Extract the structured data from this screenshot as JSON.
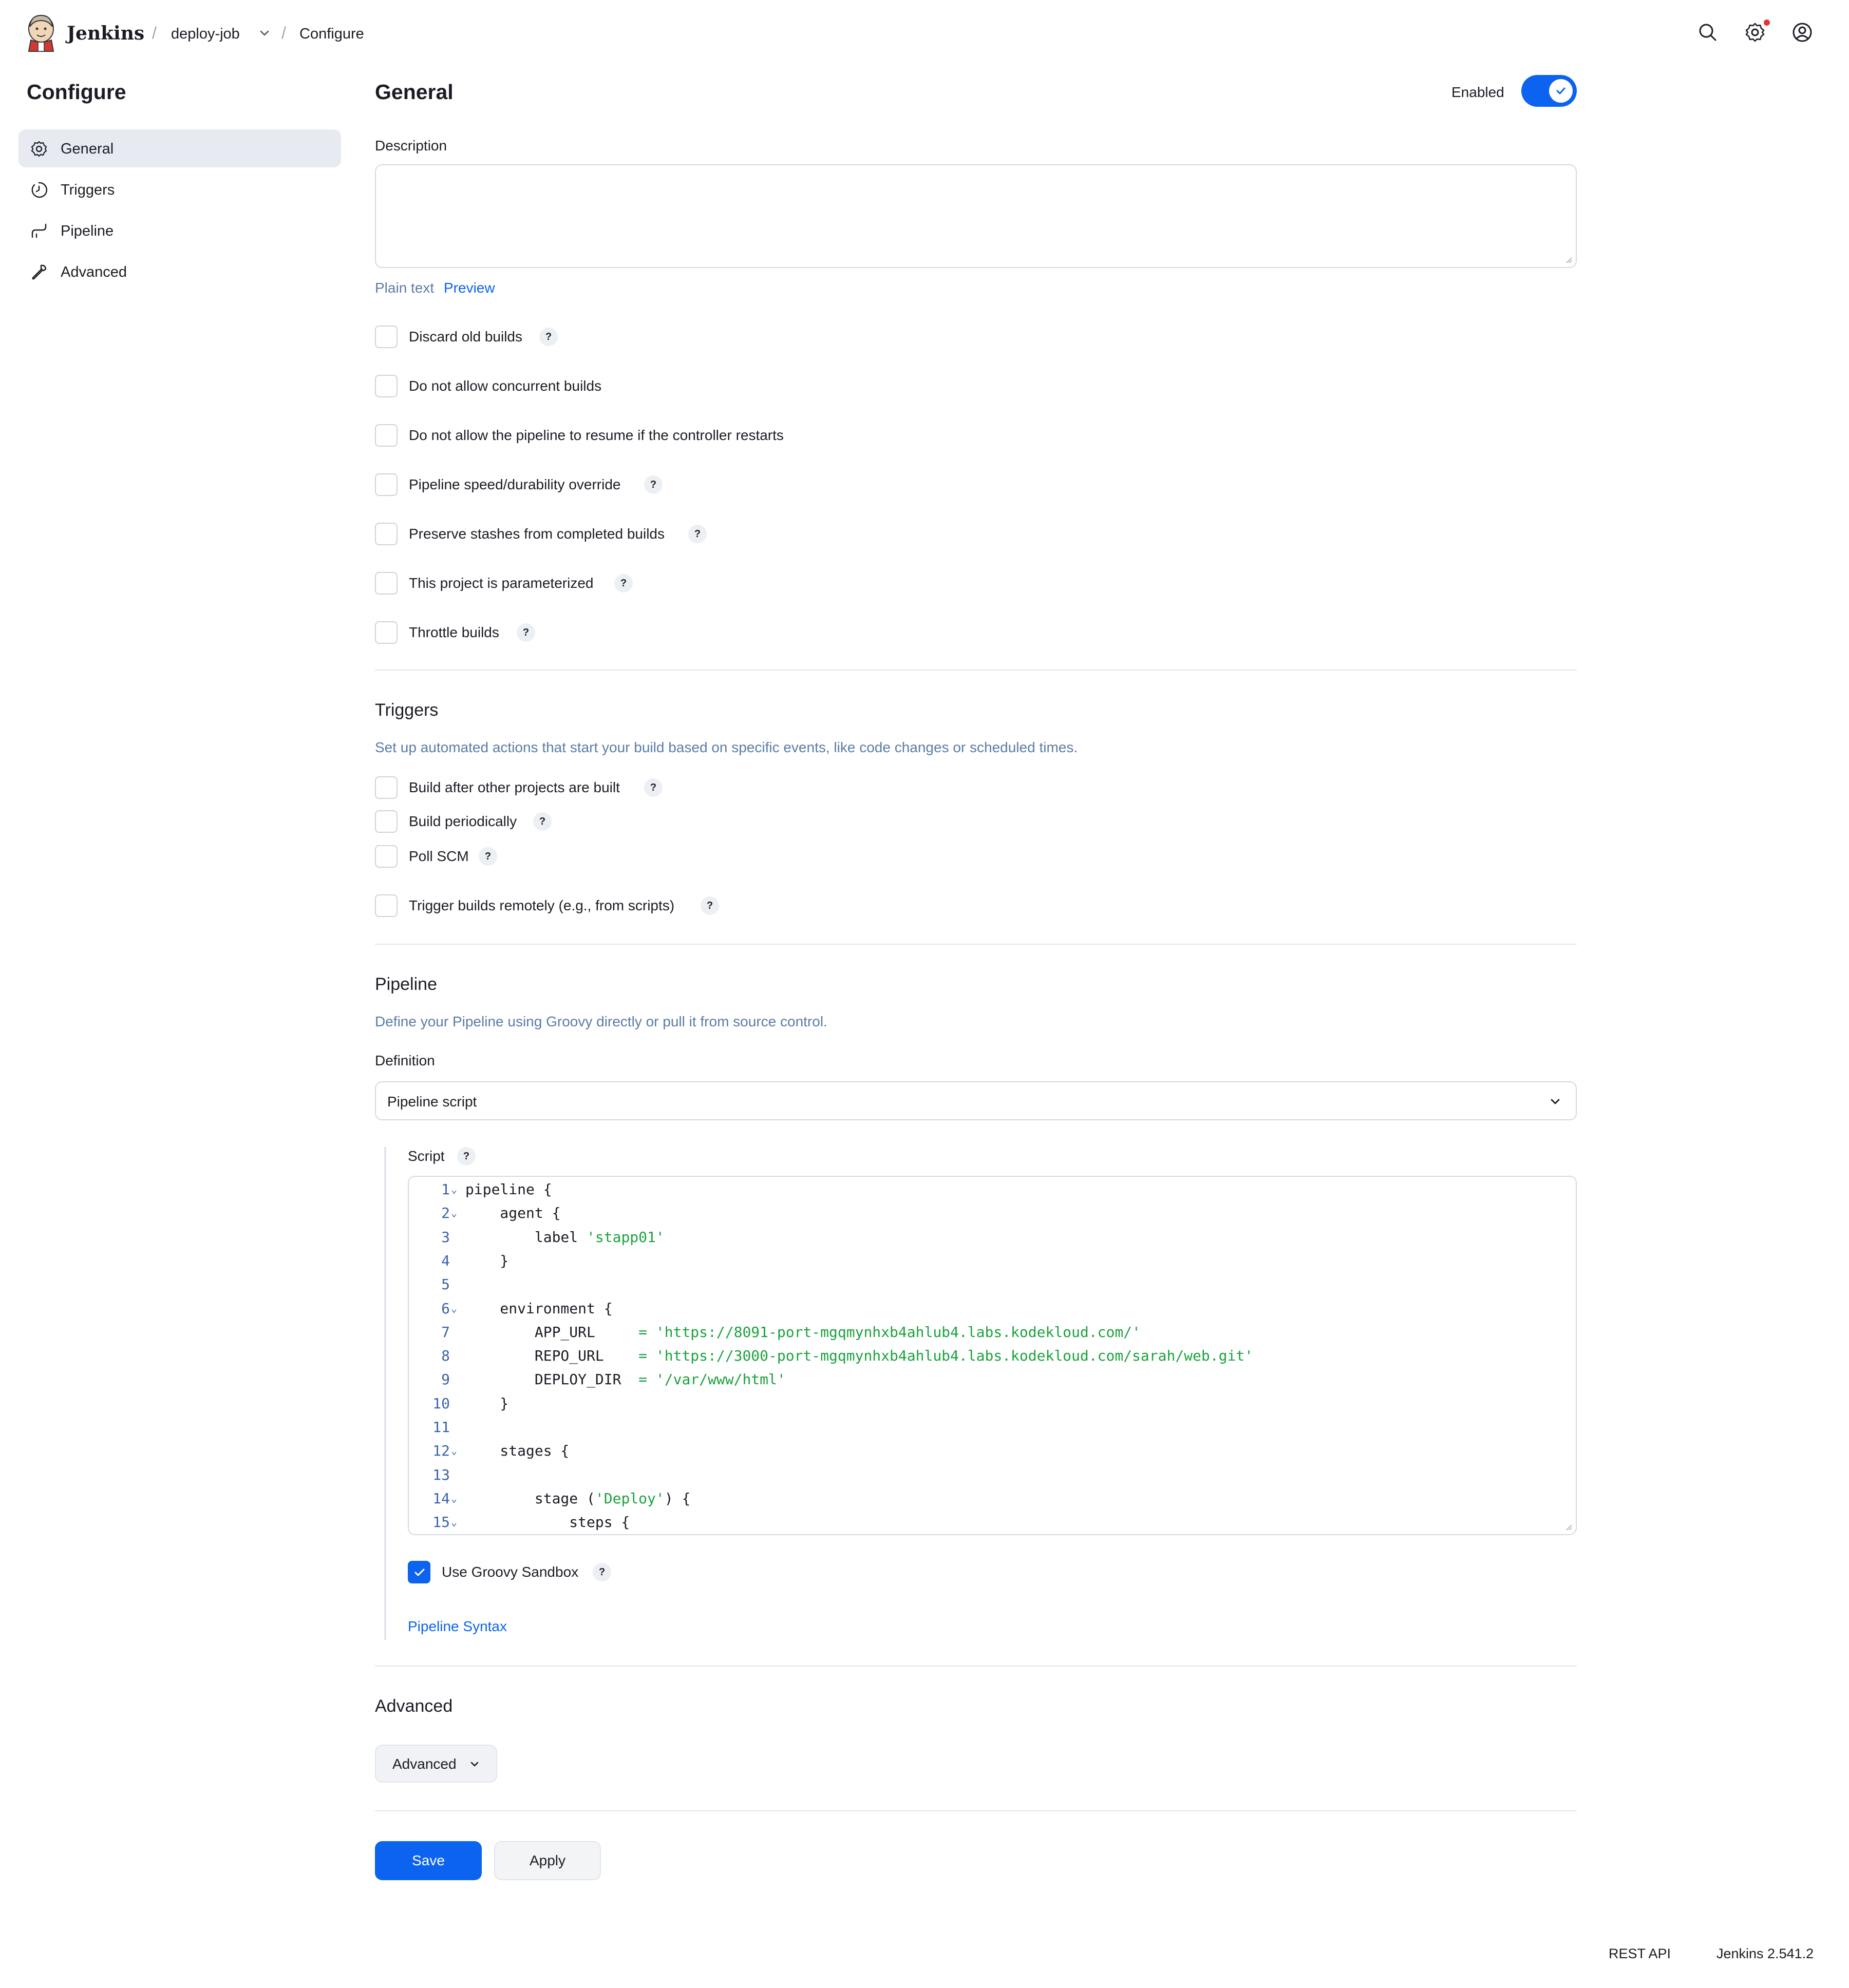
{
  "header": {
    "brand": "Jenkins",
    "breadcrumbs": [
      "deploy-job",
      "Configure"
    ]
  },
  "sidebar": {
    "title": "Configure",
    "items": [
      {
        "label": "General",
        "icon": "gear-icon",
        "active": true
      },
      {
        "label": "Triggers",
        "icon": "clock-icon",
        "active": false
      },
      {
        "label": "Pipeline",
        "icon": "pipeline-icon",
        "active": false
      },
      {
        "label": "Advanced",
        "icon": "wrench-icon",
        "active": false
      }
    ]
  },
  "general": {
    "title": "General",
    "enabled_label": "Enabled",
    "enabled": true,
    "description_label": "Description",
    "description_value": "",
    "plain_text": "Plain text",
    "preview": "Preview",
    "options": [
      {
        "label": "Discard old builds",
        "help": true,
        "checked": false
      },
      {
        "label": "Do not allow concurrent builds",
        "help": false,
        "checked": false
      },
      {
        "label": "Do not allow the pipeline to resume if the controller restarts",
        "help": false,
        "checked": false
      },
      {
        "label": "Pipeline speed/durability override",
        "help": true,
        "checked": false
      },
      {
        "label": "Preserve stashes from completed builds",
        "help": true,
        "checked": false
      },
      {
        "label": "This project is parameterized",
        "help": true,
        "checked": false
      },
      {
        "label": "Throttle builds",
        "help": true,
        "checked": false
      }
    ]
  },
  "triggers": {
    "title": "Triggers",
    "description": "Set up automated actions that start your build based on specific events, like code changes or scheduled times.",
    "options": [
      {
        "label": "Build after other projects are built",
        "checked": false
      },
      {
        "label": "Build periodically",
        "checked": false
      },
      {
        "label": "Poll SCM",
        "checked": false
      },
      {
        "label": "Trigger builds remotely (e.g., from scripts)",
        "checked": false
      }
    ]
  },
  "pipeline": {
    "title": "Pipeline",
    "description": "Define your Pipeline using Groovy directly or pull it from source control.",
    "definition_label": "Definition",
    "definition_value": "Pipeline script",
    "script_label": "Script",
    "script_lines": [
      {
        "n": "1",
        "fold": true,
        "indent": "",
        "text": "pipeline {",
        "str": "",
        "tail": ""
      },
      {
        "n": "2",
        "fold": true,
        "indent": "    ",
        "text": "agent {",
        "str": "",
        "tail": ""
      },
      {
        "n": "3",
        "fold": false,
        "indent": "        ",
        "text": "label ",
        "str": "'stapp01'",
        "tail": ""
      },
      {
        "n": "4",
        "fold": false,
        "indent": "    ",
        "text": "}",
        "str": "",
        "tail": ""
      },
      {
        "n": "5",
        "fold": false,
        "indent": "",
        "text": "",
        "str": "",
        "tail": ""
      },
      {
        "n": "6",
        "fold": true,
        "indent": "    ",
        "text": "environment {",
        "str": "",
        "tail": ""
      },
      {
        "n": "7",
        "fold": false,
        "indent": "        ",
        "text": "APP_URL     ",
        "op": "= ",
        "str": "'https://8091-port-mgqmynhxb4ahlub4.labs.kodekloud.com/'",
        "tail": ""
      },
      {
        "n": "8",
        "fold": false,
        "indent": "        ",
        "text": "REPO_URL    ",
        "op": "= ",
        "str": "'https://3000-port-mgqmynhxb4ahlub4.labs.kodekloud.com/sarah/web.git'",
        "tail": ""
      },
      {
        "n": "9",
        "fold": false,
        "indent": "        ",
        "text": "DEPLOY_DIR  ",
        "op": "= ",
        "str": "'/var/www/html'",
        "tail": ""
      },
      {
        "n": "10",
        "fold": false,
        "indent": "    ",
        "text": "}",
        "str": "",
        "tail": ""
      },
      {
        "n": "11",
        "fold": false,
        "indent": "",
        "text": "",
        "str": "",
        "tail": ""
      },
      {
        "n": "12",
        "fold": true,
        "indent": "    ",
        "text": "stages {",
        "str": "",
        "tail": ""
      },
      {
        "n": "13",
        "fold": false,
        "indent": "",
        "text": "",
        "str": "",
        "tail": ""
      },
      {
        "n": "14",
        "fold": true,
        "indent": "        ",
        "text": "stage (",
        "str": "'Deploy'",
        "tail": ") {"
      },
      {
        "n": "15",
        "fold": true,
        "indent": "            ",
        "text": "steps {",
        "str": "",
        "tail": ""
      }
    ],
    "sandbox_label": "Use Groovy Sandbox",
    "sandbox_checked": true,
    "syntax_link": "Pipeline Syntax"
  },
  "advanced": {
    "title": "Advanced",
    "button": "Advanced"
  },
  "actions": {
    "save": "Save",
    "apply": "Apply"
  },
  "footer": {
    "rest_api": "REST API",
    "version": "Jenkins 2.541.2"
  },
  "colors": {
    "accent": "#0b63f0",
    "string": "#19a23c",
    "muted": "#5a7ca5"
  }
}
